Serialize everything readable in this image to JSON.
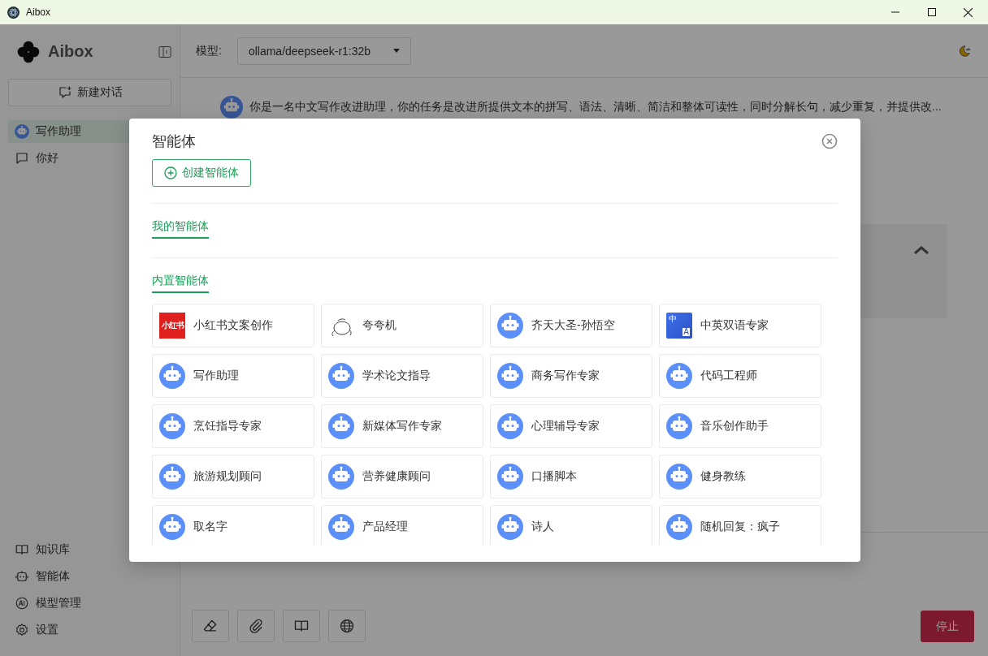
{
  "window": {
    "title": "Aibox"
  },
  "sidebar": {
    "app_name": "Aibox",
    "new_chat": "新建对话",
    "conversations": [
      {
        "label": "写作助理",
        "kind": "agent",
        "selected": true
      },
      {
        "label": "你好",
        "kind": "chat",
        "selected": false
      }
    ],
    "footer_items": [
      {
        "label": "知识库",
        "kind": "knowledge"
      },
      {
        "label": "智能体",
        "kind": "agents"
      },
      {
        "label": "模型管理",
        "kind": "models"
      },
      {
        "label": "设置",
        "kind": "settings"
      }
    ]
  },
  "header": {
    "model_label": "模型:",
    "model_value": "ollama/deepseek-r1:32b"
  },
  "chat": {
    "message": "你是一名中文写作改进助理，你的任务是改进所提供文本的拼写、语法、清晰、简洁和整体可读性，同时分解长句，减少重复，并提供改..."
  },
  "composer": {
    "tools": [
      {
        "kind": "eraser"
      },
      {
        "kind": "attach"
      },
      {
        "kind": "knowledge"
      },
      {
        "kind": "web"
      }
    ],
    "stop_button": "停止"
  },
  "dialog": {
    "title": "智能体",
    "create_button": "创建智能体",
    "sections": [
      {
        "title": "我的智能体"
      },
      {
        "title": "内置智能体",
        "agents": [
          {
            "name": "小红书文案创作",
            "kind": "brand",
            "logo_text": "小红书"
          },
          {
            "name": "夸夸机",
            "kind": "sketch"
          },
          {
            "name": "齐天大圣-孙悟空",
            "kind": "robot"
          },
          {
            "name": "中英双语专家",
            "kind": "translate",
            "logo_text": "中",
            "logo_text_2": "A"
          },
          {
            "name": "写作助理",
            "kind": "robot"
          },
          {
            "name": "学术论文指导",
            "kind": "robot"
          },
          {
            "name": "商务写作专家",
            "kind": "robot"
          },
          {
            "name": "代码工程师",
            "kind": "robot"
          },
          {
            "name": "烹饪指导专家",
            "kind": "robot"
          },
          {
            "name": "新媒体写作专家",
            "kind": "robot"
          },
          {
            "name": "心理辅导专家",
            "kind": "robot"
          },
          {
            "name": "音乐创作助手",
            "kind": "robot"
          },
          {
            "name": "旅游规划顾问",
            "kind": "robot"
          },
          {
            "name": "营养健康顾问",
            "kind": "robot"
          },
          {
            "name": "口播脚本",
            "kind": "robot"
          },
          {
            "name": "健身教练",
            "kind": "robot"
          },
          {
            "name": "取名字",
            "kind": "robot"
          },
          {
            "name": "产品经理",
            "kind": "robot"
          },
          {
            "name": "诗人",
            "kind": "robot"
          },
          {
            "name": "随机回复：疯子",
            "kind": "robot"
          }
        ]
      }
    ]
  }
}
